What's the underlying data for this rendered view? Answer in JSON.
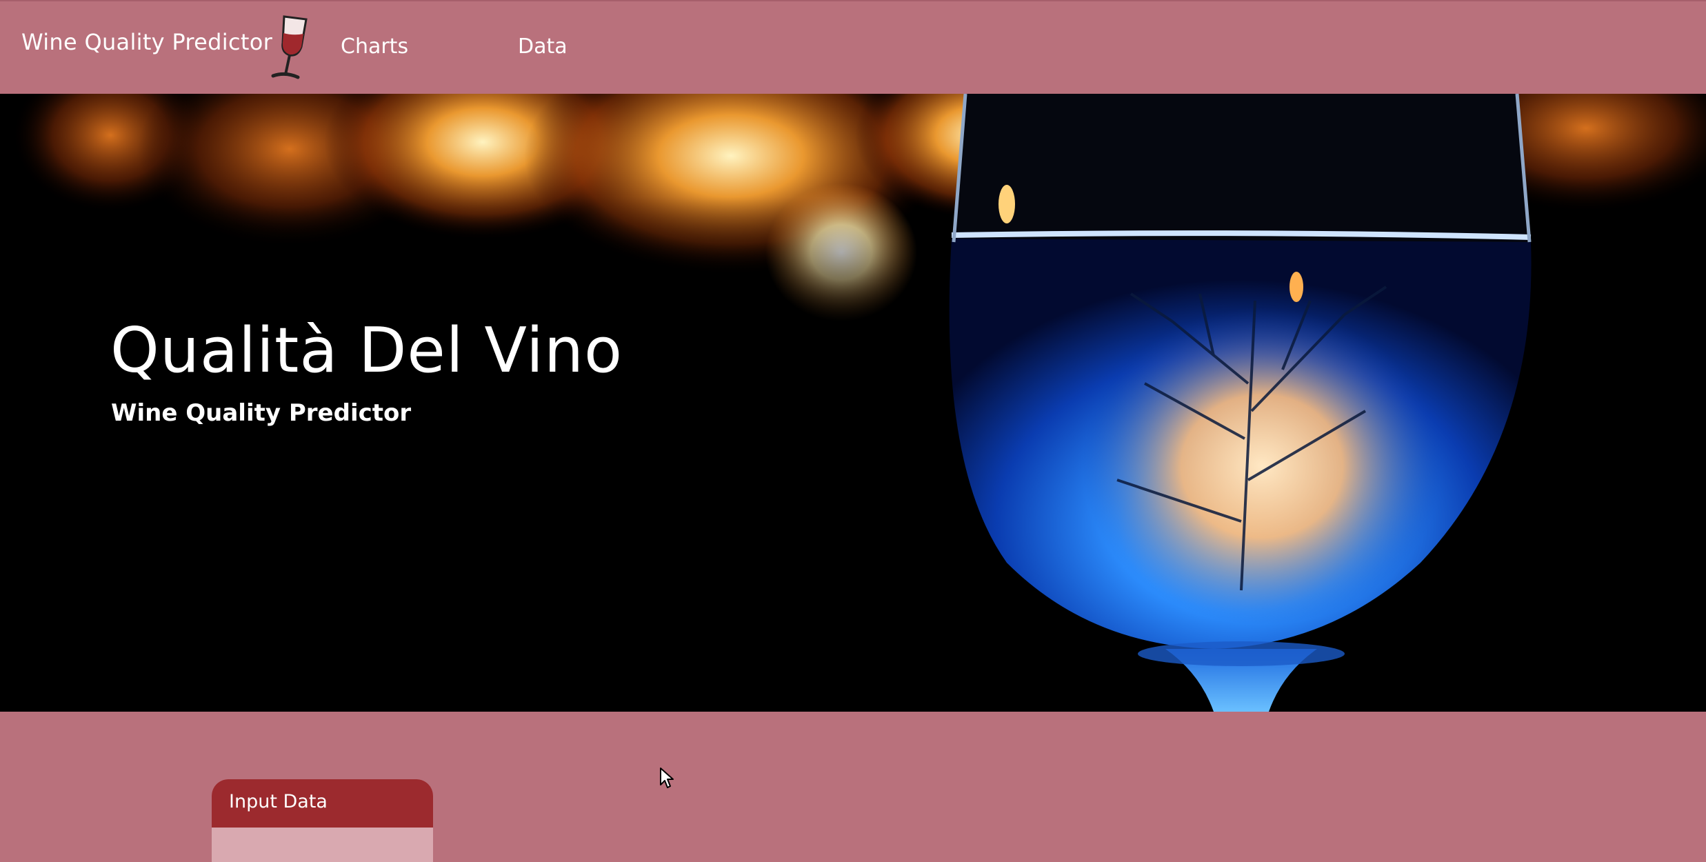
{
  "navbar": {
    "brand": "Wine Quality Predictor",
    "links": [
      "Charts",
      "Data"
    ]
  },
  "hero": {
    "title": "Qualità Del Vino",
    "subtitle": "Wine Quality Predictor"
  },
  "card": {
    "header": "Input Data"
  },
  "colors": {
    "navbar": "#b9717c",
    "card_header": "#9c2a2e",
    "glass_blue": "#1e6be0",
    "bokeh_orange": "#f5a020"
  },
  "icons": {
    "brand": "wine-glass-icon",
    "cursor": "mouse-pointer-icon"
  }
}
